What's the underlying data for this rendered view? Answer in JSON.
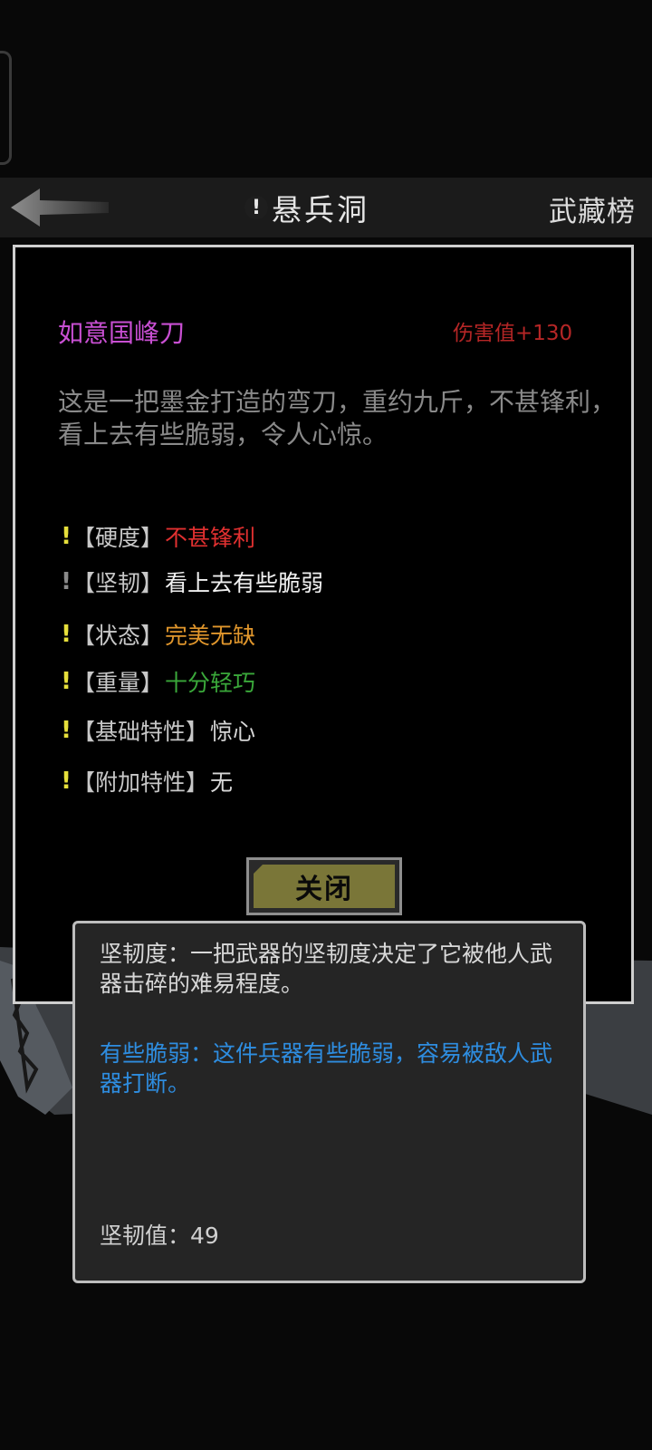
{
  "header": {
    "title": "悬兵洞",
    "title_mark": "!",
    "rank_link": "武藏榜"
  },
  "item": {
    "name": "如意国峰刀",
    "damage": "伤害值+130",
    "description": "这是一把墨金打造的弯刀，重约九斤，不甚锋利，看上去有些脆弱，令人心惊。"
  },
  "attributes": [
    {
      "mark": "!",
      "label": "【硬度】",
      "value": "不甚锋利",
      "color": "#e03030"
    },
    {
      "mark": "!",
      "label": "【坚韧】",
      "value": "看上去有些脆弱",
      "color": "#f0f0f0"
    },
    {
      "mark": "!",
      "label": "【状态】",
      "value": "完美无缺",
      "color": "#e0962c"
    },
    {
      "mark": "!",
      "label": "【重量】",
      "value": "十分轻巧",
      "color": "#3aa83a"
    },
    {
      "mark": "!",
      "label": "【基础特性】",
      "value": "惊心",
      "color": "#d6d6d6"
    },
    {
      "mark": "!",
      "label": "【附加特性】",
      "value": "无",
      "color": "#d6d6d6"
    }
  ],
  "close_button": "关闭",
  "tooltip": {
    "definition": "坚韧度：一把武器的坚韧度决定了它被他人武器击碎的难易程度。",
    "effect": "有些脆弱：这件兵器有些脆弱，容易被敌人武器打断。",
    "value_line": "坚韧值：49"
  },
  "icons": {
    "back": "back-arrow-icon"
  },
  "colors": {
    "item_name": "#c84fd2",
    "damage": "#b52626",
    "exclamation": "#e6df3b",
    "close_button_fill": "#7a7638",
    "tooltip_effect": "#2e8de0"
  }
}
